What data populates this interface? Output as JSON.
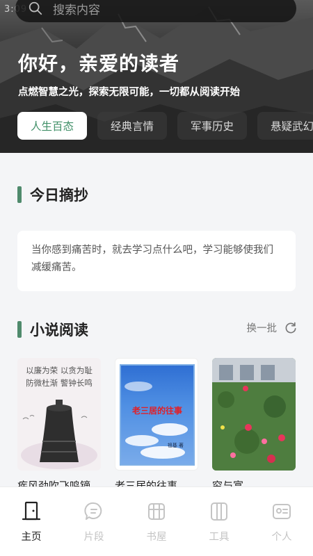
{
  "status": {
    "time": "3:09"
  },
  "search": {
    "placeholder": "搜索内容"
  },
  "hero": {
    "greeting": "你好，亲爱的读者",
    "slogan": "点燃智慧之光，探索无限可能，一切都从阅读开始",
    "tabs": [
      {
        "label": "人生百态",
        "active": true
      },
      {
        "label": "经典言情"
      },
      {
        "label": "军事历史"
      },
      {
        "label": "悬疑武幻"
      }
    ]
  },
  "excerpt_section": {
    "title": "今日摘抄",
    "text": "当你感到痛苦时，就去学习点什么吧，学习能够使我们减缓痛苦。"
  },
  "novel_section": {
    "title": "小说阅读",
    "refresh_label": "换一批",
    "books": [
      {
        "title": "疾风劲吹飞鸣镝",
        "cover_lines": [
          "以廉为荣 以贪为耻",
          "防微杜渐 警钟长鸣"
        ]
      },
      {
        "title": "老三居的往事",
        "cover_title": "老三居的往事",
        "cover_author": "祖基 著"
      },
      {
        "title": "穷与富"
      }
    ]
  },
  "bottom_nav": [
    {
      "label": "主页",
      "icon": "home-door-icon",
      "active": true
    },
    {
      "label": "片段",
      "icon": "chat-bubble-icon"
    },
    {
      "label": "书屋",
      "icon": "bookshelf-icon"
    },
    {
      "label": "工具",
      "icon": "tools-icon"
    },
    {
      "label": "个人",
      "icon": "profile-card-icon"
    }
  ],
  "colors": {
    "accent": "#3f8f67",
    "section_bar": "#4f8a6c"
  }
}
